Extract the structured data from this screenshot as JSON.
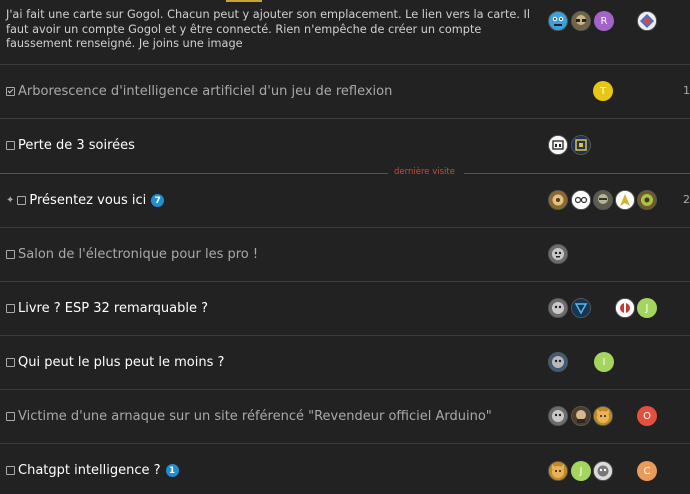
{
  "topics": [
    {
      "excerpt": "J'ai fait une carte sur Gogol. Chacun peut y ajouter son emplacement. Le lien vers la carte. Il faut avoir un compte Gogol et y être connecté. Rien n'empêche de créer un compte faussement renseigné. Je joins une image",
      "avatars": [
        "",
        "",
        "R",
        ""
      ]
    },
    {
      "title": "Arborescence d'intelligence artificiel d'un jeu de reflexion",
      "avatars": [
        "T"
      ]
    },
    {
      "title": "Perte de 3 soirées",
      "avatars": [
        "",
        ""
      ]
    },
    {
      "title": "Présentez vous ici",
      "badge": "7",
      "avatars": [
        "",
        "",
        "",
        "",
        ""
      ]
    },
    {
      "title": "Salon de l'électronique pour les pro !",
      "avatars": [
        ""
      ]
    },
    {
      "title": "Livre ? ESP 32 remarquable ?",
      "avatars": [
        "",
        "",
        "",
        "J"
      ]
    },
    {
      "title": "Qui peut le plus peut le moins ?",
      "avatars": [
        "",
        "I"
      ]
    },
    {
      "title": "Victime d'une arnaque sur un site référencé \"Revendeur officiel Arduino\"",
      "avatars": [
        "",
        "",
        "",
        "O"
      ]
    },
    {
      "title": "Chatgpt intelligence ?",
      "badge": "1",
      "avatars": [
        "",
        "J",
        "",
        "C"
      ]
    }
  ],
  "separator_label": "dernière visite",
  "edge_numbers": [
    "1",
    "2"
  ],
  "colors": {
    "background": "#222222",
    "separator": "#a33420",
    "badge": "#1e8fd0",
    "avatar_r": "#a463c9",
    "avatar_t": "#e8c618",
    "avatar_j": "#a4d55f",
    "avatar_i": "#a4d55f",
    "avatar_o": "#e3503e",
    "avatar_c": "#e99b5a"
  }
}
